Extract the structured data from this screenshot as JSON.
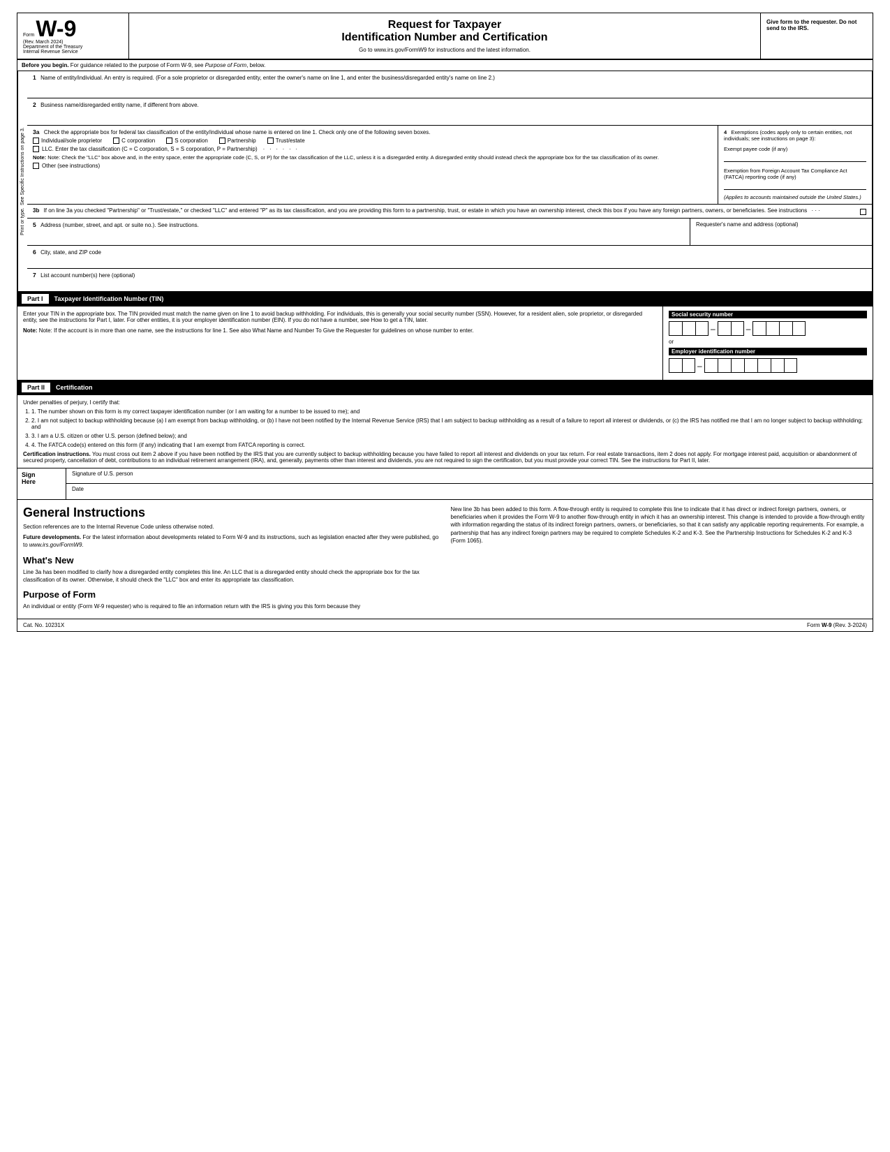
{
  "header": {
    "form_label": "Form",
    "form_number": "W-9",
    "rev_date": "(Rev. March 2024)",
    "dept": "Department of the Treasury",
    "irs": "Internal Revenue Service",
    "title1": "Request for Taxpayer",
    "title2": "Identification Number and Certification",
    "instructions_link": "Go to www.irs.gov/FormW9 for instructions and the latest information.",
    "give_form": "Give form to the requester. Do not send to the IRS."
  },
  "before_begin": {
    "text": "Before you begin. For guidance related to the purpose of Form W-9, see Purpose of Form, below."
  },
  "fields": {
    "field1_num": "1",
    "field1_label": "Name of entity/individual. An entry is required. (For a sole proprietor or disregarded entity, enter the owner's name on line 1, and enter the business/disregarded entity's name on line 2.)",
    "field2_num": "2",
    "field2_label": "Business name/disregarded entity name, if different from above.",
    "field3a_num": "3a",
    "field3a_label": "Check the appropriate box for federal tax classification of the entity/individual whose name is entered on line 1. Check only one of the following seven boxes.",
    "checkbox_individual": "Individual/sole proprietor",
    "checkbox_ccorp": "C corporation",
    "checkbox_scorp": "S corporation",
    "checkbox_partnership": "Partnership",
    "checkbox_trust": "Trust/estate",
    "checkbox_llc": "LLC. Enter the tax classification (C = C corporation, S = S corporation, P = Partnership)",
    "note_text": "Note: Check the \"LLC\" box above and, in the entry space, enter the appropriate code (C, S, or P) for the tax classification of the LLC, unless it is a disregarded entity. A disregarded entity should instead check the appropriate box for the tax classification of its owner.",
    "checkbox_other": "Other (see instructions)",
    "field3b_num": "3b",
    "field3b_text": "If on line 3a you checked \"Partnership\" or \"Trust/estate,\" or checked \"LLC\" and entered \"P\" as its tax classification, and you are providing this form to a partnership, trust, or estate in which you have an ownership interest, check this box if you have any foreign partners, owners, or beneficiaries. See instructions",
    "field4_num": "4",
    "field4_title": "Exemptions (codes apply only to certain entities, not individuals; see instructions on page 3):",
    "exempt_payee": "Exempt payee code (if any)",
    "fatca_label": "Exemption from Foreign Account Tax Compliance Act (FATCA) reporting code (if any)",
    "applies_text": "(Applies to accounts maintained outside the United States.)",
    "field5_num": "5",
    "field5_label": "Address (number, street, and apt. or suite no.). See instructions.",
    "requester_label": "Requester's name and address (optional)",
    "field6_num": "6",
    "field6_label": "City, state, and ZIP code",
    "field7_num": "7",
    "field7_label": "List account number(s) here (optional)"
  },
  "sidebar": {
    "text": "See Specific Instructions on page 3.",
    "text2": "Print or type."
  },
  "part1": {
    "label": "Part I",
    "title": "Taxpayer Identification Number (TIN)",
    "intro": "Enter your TIN in the appropriate box. The TIN provided must match the name given on line 1 to avoid backup withholding. For individuals, this is generally your social security number (SSN). However, for a resident alien, sole proprietor, or disregarded entity, see the instructions for Part I, later. For other entities, it is your employer identification number (EIN). If you do not have a number, see How to get a TIN, later.",
    "note": "Note: If the account is in more than one name, see the instructions for line 1. See also What Name and Number To Give the Requester for guidelines on whose number to enter.",
    "ssn_label": "Social security number",
    "or_text": "or",
    "ein_label": "Employer identification number"
  },
  "part2": {
    "label": "Part II",
    "title": "Certification",
    "under_penalties": "Under penalties of perjury, I certify that:",
    "cert1": "1. The number shown on this form is my correct taxpayer identification number (or I am waiting for a number to be issued to me); and",
    "cert2": "2. I am not subject to backup withholding because (a) I am exempt from backup withholding, or (b) I have not been notified by the Internal Revenue Service (IRS) that I am subject to backup withholding as a result of a failure to report all interest or dividends, or (c) the IRS has notified me that I am no longer subject to backup withholding; and",
    "cert3": "3. I am a U.S. citizen or other U.S. person (defined below); and",
    "cert4": "4. The FATCA code(s) entered on this form (if any) indicating that I am exempt from FATCA reporting is correct.",
    "cert_instructions_bold": "Certification instructions.",
    "cert_instructions": "You must cross out item 2 above if you have been notified by the IRS that you are currently subject to backup withholding because you have failed to report all interest and dividends on your tax return. For real estate transactions, item 2 does not apply. For mortgage interest paid, acquisition or abandonment of secured property, cancellation of debt, contributions to an individual retirement arrangement (IRA), and, generally, payments other than interest and dividends, you are not required to sign the certification, but you must provide your correct TIN. See the instructions for Part II, later."
  },
  "sign_here": {
    "label_line1": "Sign",
    "label_line2": "Here",
    "signature_label": "Signature of U.S. person",
    "date_label": "Date"
  },
  "general_instructions": {
    "title": "General Instructions",
    "section_refs": "Section references are to the Internal Revenue Code unless otherwise noted.",
    "future_dev_bold": "Future developments.",
    "future_dev": "For the latest information about developments related to Form W-9 and its instructions, such as legislation enacted after they were published, go to",
    "future_dev_link": "www.irs.gov/FormW9.",
    "whats_new_title": "What's New",
    "whats_new_text": "Line 3a has been modified to clarify how a disregarded entity completes this line. An LLC that is a disregarded entity should check the appropriate box for the tax classification of its owner. Otherwise, it should check the \"LLC\" box and enter its appropriate tax classification.",
    "purpose_title": "Purpose of Form",
    "purpose_text": "An individual or entity (Form W-9 requester) who is required to file an information return with the IRS is giving you this form because they",
    "right_col_text": "New line 3b has been added to this form. A flow-through entity is required to complete this line to indicate that it has direct or indirect foreign partners, owners, or beneficiaries when it provides the Form W-9 to another flow-through entity in which it has an ownership interest. This change is intended to provide a flow-through entity with information regarding the status of its indirect foreign partners, owners, or beneficiaries, so that it can satisfy any applicable reporting requirements. For example, a partnership that has any indirect foreign partners may be required to complete Schedules K-2 and K-3. See the Partnership Instructions for Schedules K-2 and K-3 (Form 1065)."
  },
  "footer": {
    "cat_no": "Cat. No. 10231X",
    "form_ref": "Form W-9 (Rev. 3-2024)"
  }
}
